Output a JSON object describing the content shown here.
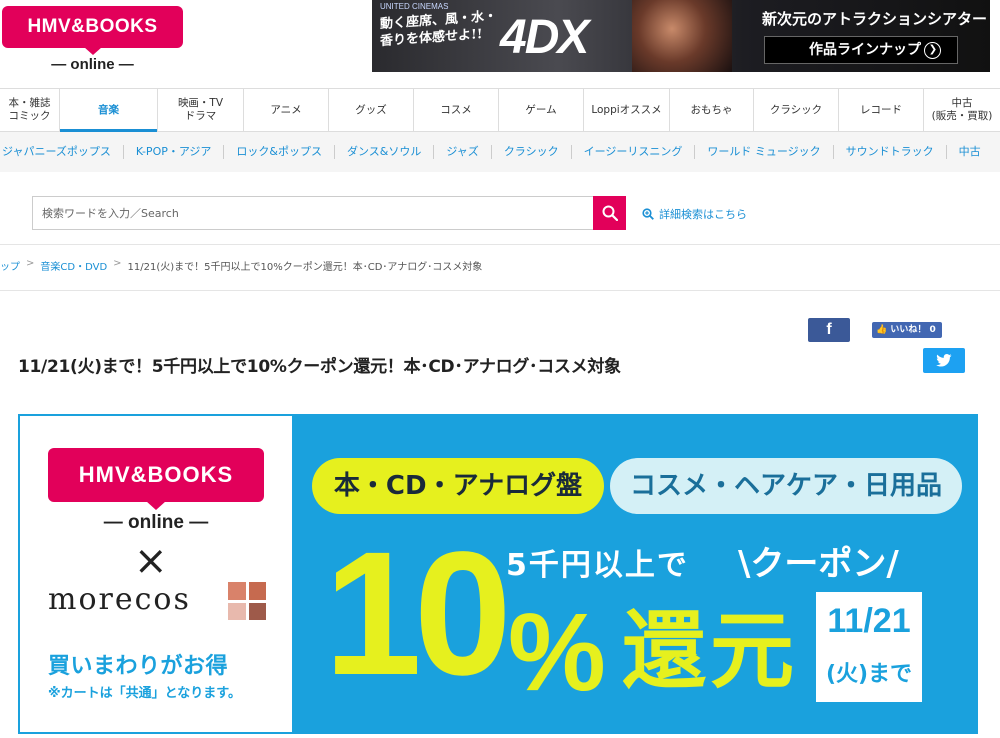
{
  "header": {
    "logo_main": "HMV&BOOKS",
    "logo_sub": "— online —",
    "ad": {
      "united_cinemas": "UNITED CINEMAS",
      "tagline": "動く座席、風・水・香りを体感せよ!!",
      "logo": "4DX",
      "headline": "新次元のアトラクションシアター",
      "button": "作品ラインナップ"
    }
  },
  "categories": [
    {
      "label": "本・雑誌\nコミック"
    },
    {
      "label": "音楽"
    },
    {
      "label": "映画・TV\nドラマ"
    },
    {
      "label": "アニメ"
    },
    {
      "label": "グッズ"
    },
    {
      "label": "コスメ"
    },
    {
      "label": "ゲーム"
    },
    {
      "label": "Loppiオススメ"
    },
    {
      "label": "おもちゃ"
    },
    {
      "label": "クラシック"
    },
    {
      "label": "レコード"
    },
    {
      "label": "中古\n(販売・買取)"
    }
  ],
  "subcategories": [
    "ジャパニーズポップス",
    "K-POP・アジア",
    "ロック&ポップス",
    "ダンス&ソウル",
    "ジャズ",
    "クラシック",
    "イージーリスニング",
    "ワールド ミュージック",
    "サウンドトラック",
    "中古"
  ],
  "search": {
    "placeholder": "検索ワードを入力／Search",
    "advanced": "詳細検索はこちら"
  },
  "breadcrumb": {
    "first": "ップ",
    "second": "音楽CD・DVD",
    "current": "11/21(火)まで！5千円以上で10%クーポン還元！本･CD･アナログ･コスメ対象"
  },
  "title": "11/21(火)まで！5千円以上で10%クーポン還元！本･CD･アナログ･コスメ対象",
  "social": {
    "facebook": "f",
    "like": "いいね！ 0"
  },
  "hero": {
    "logo_main": "HMV&BOOKS",
    "logo_sub": "— online —",
    "cross": "×",
    "partner": "morecos",
    "tagline": "買いまわりがお得",
    "note": "※カートは「共通」となります。",
    "pill_books": "本・CD・アナログ盤",
    "pill_cosme": "コスメ・ヘアケア・日用品",
    "ten": "10",
    "five": "5千円以上で",
    "coupon": "\\クーポン/",
    "percent": "%",
    "kangen": "還元",
    "date": "11/21",
    "until": "(火)まで"
  }
}
